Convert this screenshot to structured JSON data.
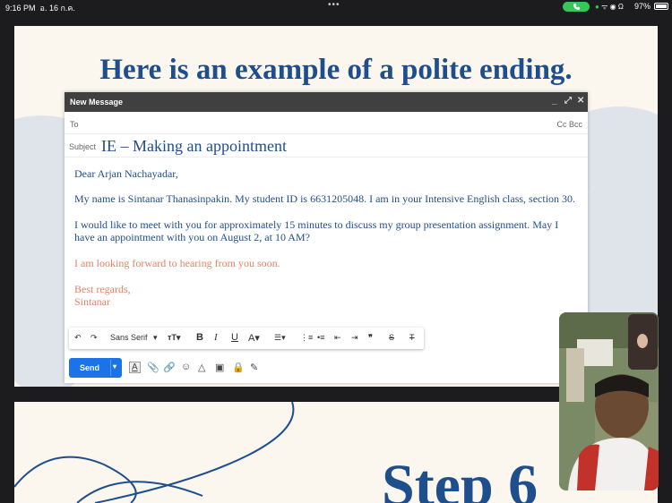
{
  "status_bar": {
    "time": "9:16 PM",
    "date": "อ. 16 ก.ค.",
    "battery": "97%"
  },
  "slide1": {
    "title": "Here is an example of a polite ending."
  },
  "compose": {
    "header": "New Message",
    "to_label": "To",
    "cc_bcc": "Cc Bcc",
    "subject_label": "Subject",
    "subject": "IE – Making an appointment",
    "body": {
      "greeting": "Dear Arjan Nachayadar,",
      "para1": "My name is Sintanar Thanasinpakin. My student ID is 6631205048. I am in your Intensive English class, section 30.",
      "para2_line1": "I would like to meet with you for approximately 15 minutes to discuss my group presentation assignment. May  I",
      "para2_line2": "have an appointment with you on August 2, at 10 AM?",
      "closing_line": "I am looking forward to hearing from you soon.",
      "sign_off": "Best regards,",
      "name": "Sintanar"
    },
    "toolbar": {
      "font": "Sans Serif"
    },
    "send_label": "Send"
  },
  "slide2": {
    "title": "Step 6"
  },
  "colors": {
    "title_blue": "#1f4e8c",
    "closing_orange": "#e38363",
    "send_blue": "#1a73e8",
    "call_green": "#34c759"
  }
}
